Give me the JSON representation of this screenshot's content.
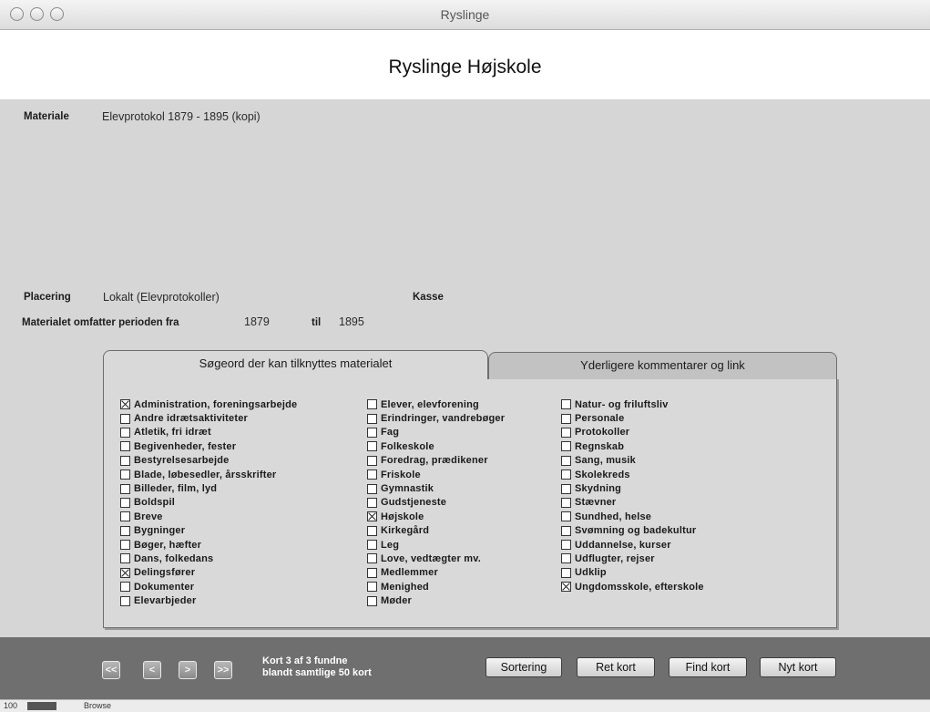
{
  "window": {
    "title": "Ryslinge"
  },
  "header": {
    "title": "Ryslinge Højskole"
  },
  "form": {
    "materiale_label": "Materiale",
    "materiale_value": "Elevprotokol 1879 - 1895 (kopi)",
    "placering_label": "Placering",
    "placering_value": "Lokalt (Elevprotokoller)",
    "kasse_label": "Kasse",
    "periode_label": "Materialet omfatter perioden fra",
    "periode_from": "1879",
    "til_label": "til",
    "periode_to": "1895"
  },
  "tabs": [
    {
      "label": "Søgeord der kan tilknyttes materialet",
      "active": true
    },
    {
      "label": "Yderligere kommentarer og link",
      "active": false
    }
  ],
  "keywords": {
    "col1": [
      {
        "label": "Administration, foreningsarbejde",
        "checked": true
      },
      {
        "label": "Andre idrætsaktiviteter",
        "checked": false
      },
      {
        "label": "Atletik, fri idræt",
        "checked": false
      },
      {
        "label": "Begivenheder, fester",
        "checked": false
      },
      {
        "label": "Bestyrelsesarbejde",
        "checked": false
      },
      {
        "label": "Blade, løbesedler, årsskrifter",
        "checked": false
      },
      {
        "label": "Billeder, film, lyd",
        "checked": false
      },
      {
        "label": "Boldspil",
        "checked": false
      },
      {
        "label": "Breve",
        "checked": false
      },
      {
        "label": "Bygninger",
        "checked": false
      },
      {
        "label": "Bøger, hæfter",
        "checked": false
      },
      {
        "label": "Dans, folkedans",
        "checked": false
      },
      {
        "label": "Delingsfører",
        "checked": true
      },
      {
        "label": "Dokumenter",
        "checked": false
      },
      {
        "label": "Elevarbjeder",
        "checked": false
      }
    ],
    "col2": [
      {
        "label": "Elever, elevforening",
        "checked": false
      },
      {
        "label": "Erindringer, vandrebøger",
        "checked": false
      },
      {
        "label": "Fag",
        "checked": false
      },
      {
        "label": "Folkeskole",
        "checked": false
      },
      {
        "label": "Foredrag, prædikener",
        "checked": false
      },
      {
        "label": "Friskole",
        "checked": false
      },
      {
        "label": "Gymnastik",
        "checked": false
      },
      {
        "label": "Gudstjeneste",
        "checked": false
      },
      {
        "label": "Højskole",
        "checked": true
      },
      {
        "label": "Kirkegård",
        "checked": false
      },
      {
        "label": "Leg",
        "checked": false
      },
      {
        "label": "Love, vedtægter mv.",
        "checked": false
      },
      {
        "label": "Medlemmer",
        "checked": false
      },
      {
        "label": "Menighed",
        "checked": false
      },
      {
        "label": "Møder",
        "checked": false
      }
    ],
    "col3": [
      {
        "label": "Natur- og friluftsliv",
        "checked": false
      },
      {
        "label": "Personale",
        "checked": false
      },
      {
        "label": "Protokoller",
        "checked": false
      },
      {
        "label": "Regnskab",
        "checked": false
      },
      {
        "label": "Sang, musik",
        "checked": false
      },
      {
        "label": "Skolekreds",
        "checked": false
      },
      {
        "label": "Skydning",
        "checked": false
      },
      {
        "label": "Stævner",
        "checked": false
      },
      {
        "label": "Sundhed, helse",
        "checked": false
      },
      {
        "label": "Svømning og badekultur",
        "checked": false
      },
      {
        "label": "Uddannelse, kurser",
        "checked": false
      },
      {
        "label": "Udflugter, rejser",
        "checked": false
      },
      {
        "label": "Udklip",
        "checked": false
      },
      {
        "label": "Ungdomsskole, efterskole",
        "checked": true
      }
    ]
  },
  "nav": {
    "first": "<<",
    "prev": "<",
    "next": ">",
    "last": ">>",
    "status_line1": "Kort 3 af 3 fundne",
    "status_line2": "blandt samtlige 50 kort"
  },
  "actions": {
    "sortering": "Sortering",
    "ret_kort": "Ret kort",
    "find_kort": "Find kort",
    "nyt_kort": "Nyt kort"
  },
  "statusbar": {
    "zoom": "100",
    "mode": "Browse"
  },
  "colors": {
    "panel": "#d6d6d6",
    "bottombar": "#6f6f6f"
  }
}
